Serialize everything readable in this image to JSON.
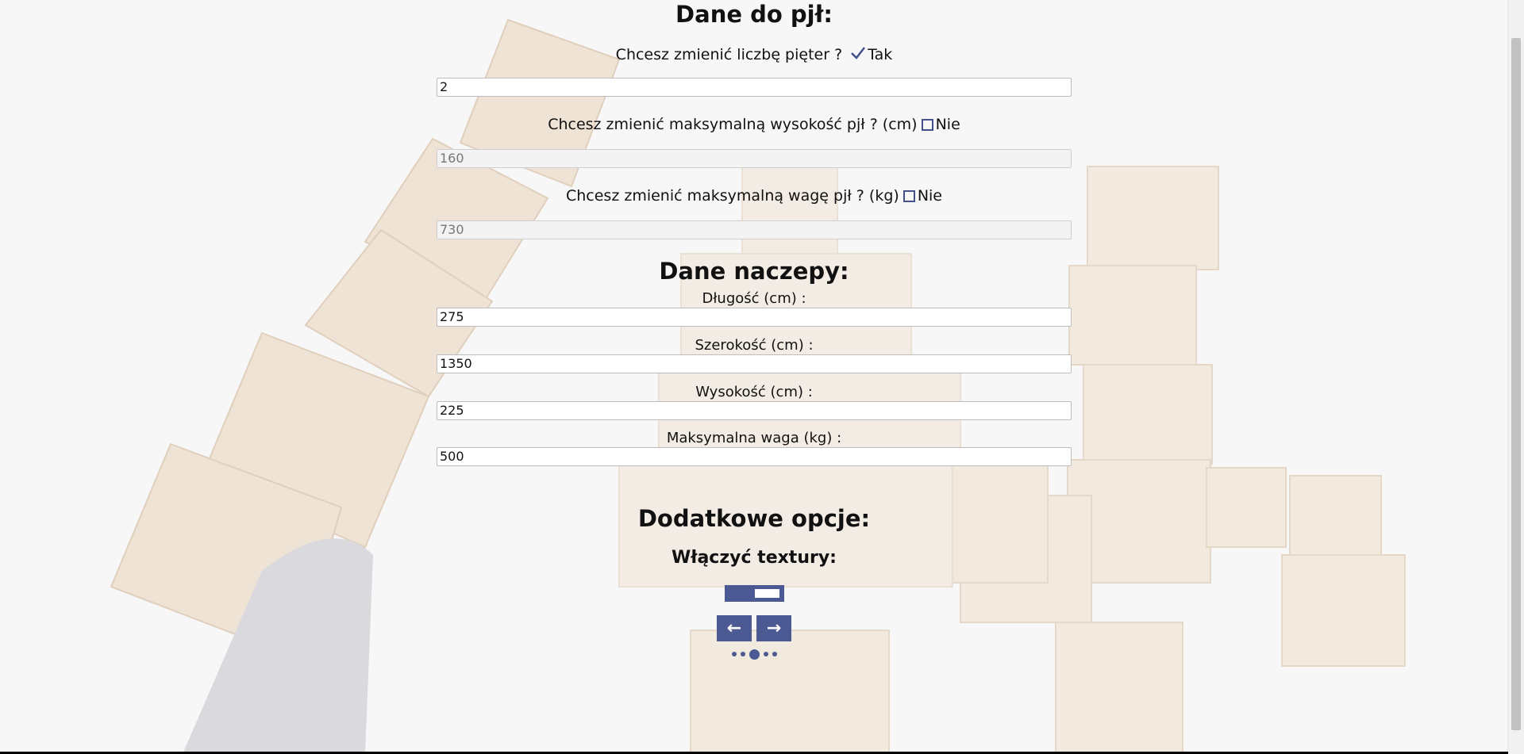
{
  "pjl": {
    "heading": "Dane do pjł:",
    "floors": {
      "question": "Chcesz zmienić liczbę pięter ?",
      "answer": "Tak",
      "checked": true,
      "value": "2"
    },
    "max_height": {
      "question": "Chcesz zmienić maksymalną wysokość pjł ? (cm)",
      "answer": "Nie",
      "checked": false,
      "value": "160"
    },
    "max_weight": {
      "question": "Chcesz zmienić maksymalną wagę pjł ? (kg)",
      "answer": "Nie",
      "checked": false,
      "value": "730"
    }
  },
  "trailer": {
    "heading": "Dane naczepy:",
    "length": {
      "label": "Długość (cm) :",
      "value": "275"
    },
    "width": {
      "label": "Szerokość (cm) :",
      "value": "1350"
    },
    "height": {
      "label": "Wysokość (cm) :",
      "value": "225"
    },
    "max_weight": {
      "label": "Maksymalna waga (kg) :",
      "value": "500"
    }
  },
  "extra": {
    "heading": "Dodatkowe opcje:",
    "textures_label": "Włączyć textury:",
    "textures_enabled": true
  },
  "nav": {
    "prev_icon": "arrow-left-icon",
    "next_icon": "arrow-right-icon"
  },
  "pager": {
    "total": 5,
    "current": 3
  },
  "colors": {
    "accent": "#4b5a92",
    "text": "#111111",
    "background": "#f6f6f6"
  }
}
